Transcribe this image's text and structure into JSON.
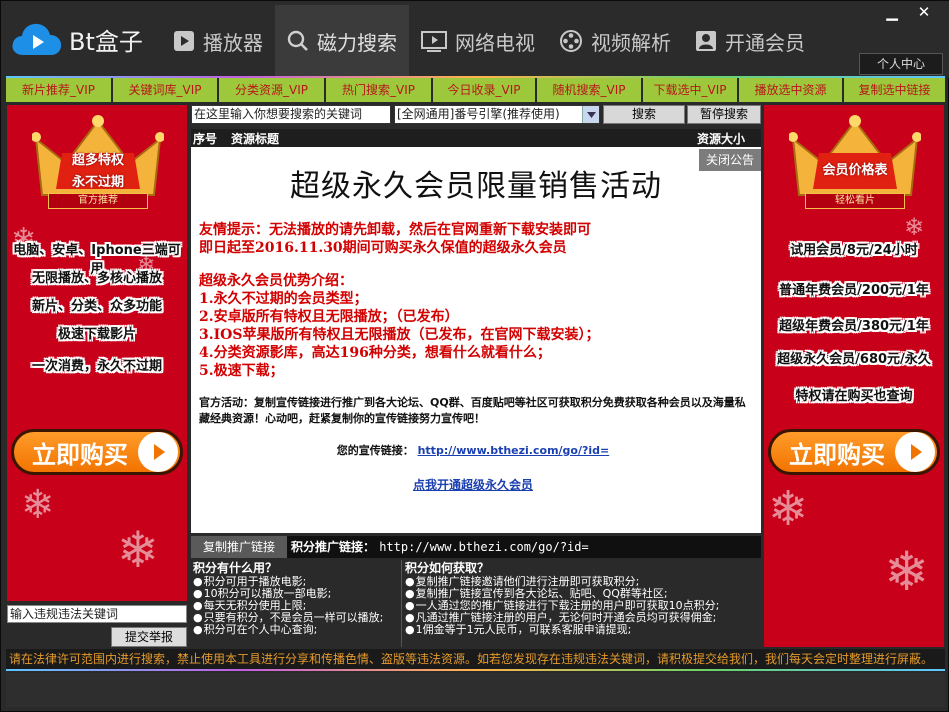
{
  "app": {
    "title": "Bt盒子"
  },
  "nav": [
    {
      "label": "播放器",
      "icon": "play-icon"
    },
    {
      "label": "磁力搜索",
      "icon": "search-icon"
    },
    {
      "label": "网络电视",
      "icon": "tv-icon"
    },
    {
      "label": "视频解析",
      "icon": "film-reel-icon"
    },
    {
      "label": "开通会员",
      "icon": "user-icon"
    }
  ],
  "window": {
    "minimize": "▁",
    "close": "✕",
    "personal_center": "个人中心"
  },
  "tabs": [
    "新片推荐_VIP",
    "关键词库_VIP",
    "分类资源_VIP",
    "热门搜索_VIP",
    "今日收录_VIP",
    "随机搜索_VIP",
    "下载选中_VIP",
    "播放选中资源",
    "复制选中链接"
  ],
  "search": {
    "placeholder": "在这里输入你想要搜索的关键词",
    "engine_selected": "[全网通用]番号引擎(推荐使用)",
    "search_button": "搜索",
    "pause_button": "暂停搜索"
  },
  "list": {
    "col_no": "序号",
    "col_title": "资源标题",
    "col_size": "资源大小"
  },
  "notice": {
    "close": "关闭公告",
    "title": "超级永久会员限量销售活动",
    "tip1": "友情提示：无法播放的请先卸载，然后在官网重新下载安装即可",
    "tip2": "即日起至2016.11.30期间可购买永久保值的超级永久会员",
    "adv_head": "超级永久会员优势介绍：",
    "adv1": "1.永久不过期的会员类型；",
    "adv2": "2.安卓版所有特权且无限播放；（已发布）",
    "adv3": "3.IOS苹果版所有特权且无限播放（已发布，在官网下载安装）；",
    "adv4": "4.分类资源影库，高达196种分类，想看什么就看什么；",
    "adv5": "5.极速下载；",
    "activity": "官方活动：复制宣传链接进行推广到各大论坛、QQ群、百度贴吧等社区可获取积分免费获取各种会员以及海量私藏经典资源！心动吧，赶紧复制你的宣传链接努力宣传吧！",
    "link_label": "您的宣传链接：",
    "link_url": "http://www.bthezi.com/go/?id=",
    "open_vip": "点我开通超级永久会员"
  },
  "promo": {
    "copy_button": "复制推广链接",
    "label": "积分推广链接：",
    "url": "http://www.bthezi.com/go/?id="
  },
  "points": {
    "left_head": "积分有什么用？",
    "left": [
      "积分可用于播放电影;",
      "10积分可以播放一部电影;",
      "每天无积分使用上限;",
      "只要有积分，不是会员一样可以播放;",
      "积分可在个人中心查询;"
    ],
    "right_head": "积分如何获取？",
    "right": [
      "复制推广链接邀请他们进行注册即可获取积分;",
      "复制推广链接宣传到各大论坛、贴吧、QQ群等社区;",
      "一人通过您的推广链接进行下载注册的用户即可获取10点积分;",
      "凡通过推广链接注册的用户，无论何时开通会员均可获得佣金;",
      "1佣金等于1元人民币，可联系客服申请提现;"
    ]
  },
  "left_banner": {
    "crown_line1": "超多特权",
    "crown_line2": "永不过期",
    "crown_sub": "官方推荐",
    "lines": [
      "电脑、安卓、Iphone三端可用",
      "无限播放、多核心播放",
      "新片、分类、众多功能",
      "极速下载影片",
      "一次消费，永久不过期"
    ],
    "buy": "立即购买"
  },
  "right_banner": {
    "crown_line1": "会员价格表",
    "crown_sub": "轻松看片",
    "lines": [
      "试用会员/8元/24小时",
      "普通年费会员/200元/1年",
      "超级年费会员/380元/1年",
      "超级永久会员/680元/永久",
      "特权请在购买也查询"
    ],
    "buy": "立即购买"
  },
  "report": {
    "placeholder": "输入违规违法关键词",
    "button": "提交举报"
  },
  "disclaimer": "请在法律许可范围内进行搜索，禁止使用本工具进行分享和传播色情、盗版等违法资源。如若您发现存在违规违法关键词，请积极提交给我们，我们每天会定时整理进行屏蔽。",
  "colors": {
    "tab_bg": "#9ec83c",
    "tab_text": "#b7161a",
    "banner_red": "#c8001a",
    "buy_orange": "#f27400",
    "notice_red": "#d20000",
    "link_blue": "#1a3fb0",
    "disclaimer": "#e49a2c"
  }
}
